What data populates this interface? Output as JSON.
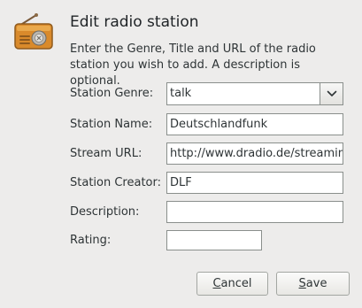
{
  "dialog": {
    "title": "Edit radio station",
    "intro": "Enter the Genre, Title and URL of the radio station you wish to add. A description is optional."
  },
  "fields": {
    "genre": {
      "label": "Station Genre:",
      "value": "talk"
    },
    "name": {
      "label": "Station Name:",
      "value": "Deutschlandfunk"
    },
    "url": {
      "label": "Stream URL:",
      "value": "http://www.dradio.de/streaming"
    },
    "creator": {
      "label": "Station Creator:",
      "value": "DLF"
    },
    "description": {
      "label": "Description:",
      "value": ""
    },
    "rating": {
      "label": "Rating:",
      "value": ""
    }
  },
  "buttons": {
    "cancel": {
      "mnemonic": "C",
      "rest": "ancel"
    },
    "save": {
      "mnemonic": "S",
      "rest": "ave"
    }
  },
  "icons": {
    "dialog_icon": "radio-icon",
    "combo_arrow": "chevron-down-icon"
  }
}
